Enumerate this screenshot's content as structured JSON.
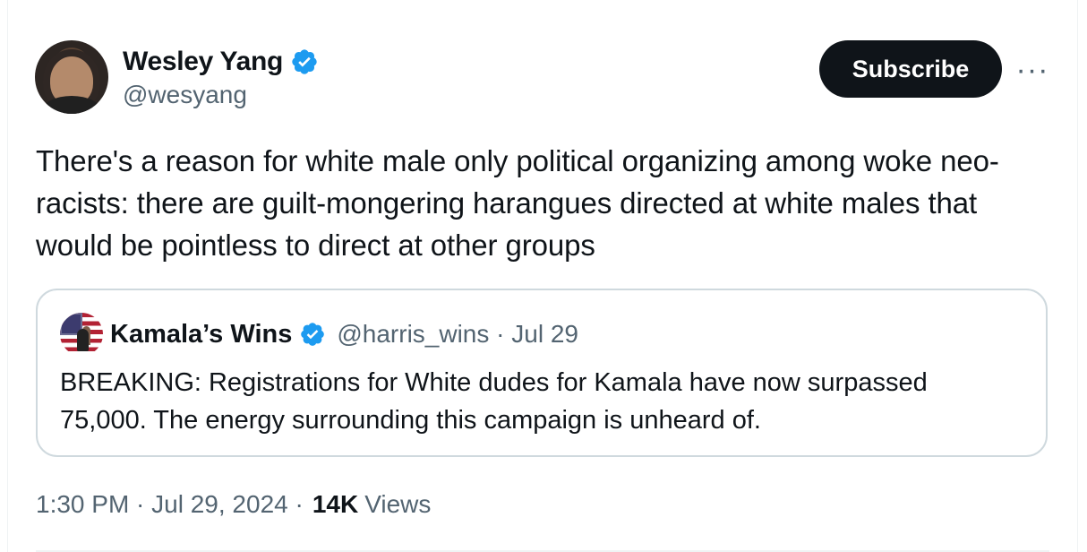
{
  "tweet": {
    "author": {
      "name": "Wesley Yang",
      "handle": "@wesyang",
      "avatar_icon": "profile-photo-icon",
      "verified_icon": "verified-badge-icon",
      "verified_color": "#1d9bf0"
    },
    "actions": {
      "subscribe_label": "Subscribe",
      "more_label": "···"
    },
    "text": "There's a reason for white male only political organizing among woke neo-racists: there are guilt-mongering harangues directed at white males that would be pointless to direct at other groups",
    "quoted_tweet": {
      "author": {
        "name": "Kamala’s Wins",
        "handle_and_date": "@harris_wins · Jul 29",
        "avatar_icon": "flag-profile-photo-icon",
        "verified_icon": "verified-badge-icon"
      },
      "text": "BREAKING: Registrations for White dudes for Kamala have now surpassed 75,000. The energy surrounding this campaign is unheard of."
    },
    "meta": {
      "timestamp": "1:30 PM · Jul 29, 2024 ·",
      "views_count": "14K",
      "views_label": "Views"
    }
  },
  "colors": {
    "text": "#0f1419",
    "secondary_text": "#536471",
    "border": "#cfd9de",
    "button": "#0f1419",
    "verified": "#1d9bf0"
  }
}
